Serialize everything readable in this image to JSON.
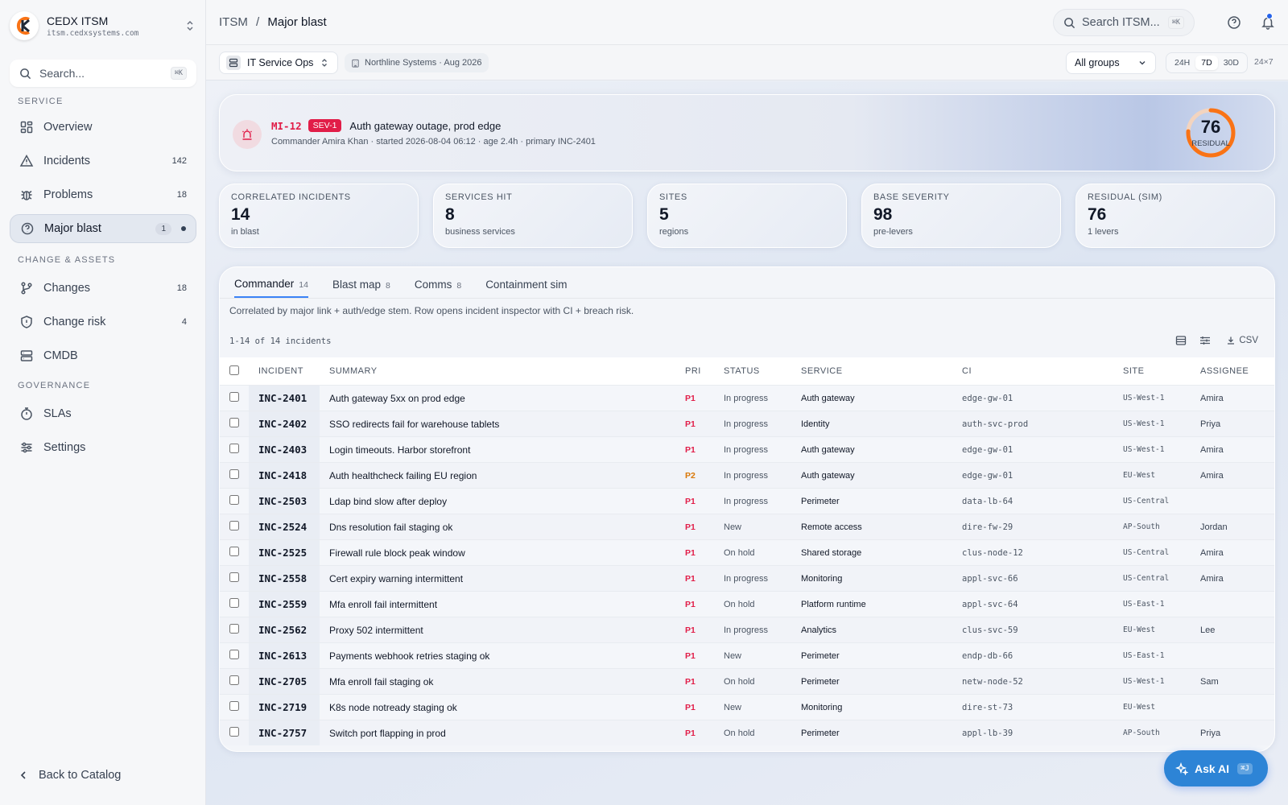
{
  "brand": {
    "name": "CEDX ITSM",
    "host": "itsm.cedxsystems.com"
  },
  "sidebar": {
    "search_placeholder": "Search...",
    "search_kbd": "⌘K",
    "sections": [
      "SERVICE",
      "CHANGE & ASSETS",
      "GOVERNANCE"
    ],
    "items": [
      {
        "label": "Overview",
        "count": "",
        "icon": "grid-icon"
      },
      {
        "label": "Incidents",
        "count": "142",
        "icon": "alert-triangle-icon"
      },
      {
        "label": "Problems",
        "count": "18",
        "icon": "bug-icon"
      },
      {
        "label": "Major blast",
        "count": "1",
        "icon": "help-circle-icon",
        "active": true
      },
      {
        "label": "Changes",
        "count": "18",
        "icon": "git-branch-icon"
      },
      {
        "label": "Change risk",
        "count": "4",
        "icon": "shield-icon"
      },
      {
        "label": "CMDB",
        "count": "",
        "icon": "server-icon"
      },
      {
        "label": "SLAs",
        "count": "",
        "icon": "timer-icon"
      },
      {
        "label": "Settings",
        "count": "",
        "icon": "sliders-icon"
      }
    ],
    "back_label": "Back to Catalog"
  },
  "topbar": {
    "crumb_root": "ITSM",
    "crumb_sep": "/",
    "crumb_current": "Major blast",
    "search_placeholder": "Search ITSM...",
    "search_kbd": "⌘K"
  },
  "subbar": {
    "workspace": "IT Service Ops",
    "context": "Northline Systems · Aug 2026",
    "group_select": "All groups",
    "ranges": [
      "24H",
      "7D",
      "30D"
    ],
    "range_active": "7D",
    "coverage": "24×7"
  },
  "hero": {
    "id": "MI-12",
    "severity": "SEV-1",
    "title": "Auth gateway outage, prod edge",
    "meta": "Commander Amira Khan · started 2026-08-04 06:12 · age 2.4h · primary INC-2401",
    "gauge_value": "76",
    "gauge_label": "RESIDUAL",
    "gauge_fraction": 0.76,
    "colors": {
      "accent": "#e11d48",
      "gauge": "#f97316"
    }
  },
  "kpis": [
    {
      "label": "CORRELATED INCIDENTS",
      "value": "14",
      "sub": "in blast"
    },
    {
      "label": "SERVICES HIT",
      "value": "8",
      "sub": "business services"
    },
    {
      "label": "SITES",
      "value": "5",
      "sub": "regions"
    },
    {
      "label": "BASE SEVERITY",
      "value": "98",
      "sub": "pre-levers"
    },
    {
      "label": "RESIDUAL (SIM)",
      "value": "76",
      "sub": "1 levers"
    }
  ],
  "tabs": [
    {
      "label": "Commander",
      "count": "14"
    },
    {
      "label": "Blast map",
      "count": "8"
    },
    {
      "label": "Comms",
      "count": "8"
    },
    {
      "label": "Containment sim",
      "count": ""
    }
  ],
  "description": "Correlated by major link + auth/edge stem. Row opens incident inspector with CI + breach risk.",
  "range_text": "1-14 of 14 incidents",
  "csv_label": "CSV",
  "columns": [
    "INCIDENT",
    "SUMMARY",
    "PRI",
    "STATUS",
    "SERVICE",
    "CI",
    "SITE",
    "ASSIGNEE"
  ],
  "rows": [
    {
      "id": "INC-2401",
      "summary": "Auth gateway 5xx on prod edge",
      "pri": "P1",
      "status": "In progress",
      "service": "Auth gateway",
      "ci": "edge-gw-01",
      "site": "US-West-1",
      "assignee": "Amira"
    },
    {
      "id": "INC-2402",
      "summary": "SSO redirects fail for warehouse tablets",
      "pri": "P1",
      "status": "In progress",
      "service": "Identity",
      "ci": "auth-svc-prod",
      "site": "US-West-1",
      "assignee": "Priya"
    },
    {
      "id": "INC-2403",
      "summary": "Login timeouts. Harbor storefront",
      "pri": "P1",
      "status": "In progress",
      "service": "Auth gateway",
      "ci": "edge-gw-01",
      "site": "US-West-1",
      "assignee": "Amira"
    },
    {
      "id": "INC-2418",
      "summary": "Auth healthcheck failing EU region",
      "pri": "P2",
      "status": "In progress",
      "service": "Auth gateway",
      "ci": "edge-gw-01",
      "site": "EU-West",
      "assignee": "Amira"
    },
    {
      "id": "INC-2503",
      "summary": "Ldap bind slow after deploy",
      "pri": "P1",
      "status": "In progress",
      "service": "Perimeter",
      "ci": "data-lb-64",
      "site": "US-Central",
      "assignee": ""
    },
    {
      "id": "INC-2524",
      "summary": "Dns resolution fail staging ok",
      "pri": "P1",
      "status": "New",
      "service": "Remote access",
      "ci": "dire-fw-29",
      "site": "AP-South",
      "assignee": "Jordan"
    },
    {
      "id": "INC-2525",
      "summary": "Firewall rule block peak window",
      "pri": "P1",
      "status": "On hold",
      "service": "Shared storage",
      "ci": "clus-node-12",
      "site": "US-Central",
      "assignee": "Amira"
    },
    {
      "id": "INC-2558",
      "summary": "Cert expiry warning intermittent",
      "pri": "P1",
      "status": "In progress",
      "service": "Monitoring",
      "ci": "appl-svc-66",
      "site": "US-Central",
      "assignee": "Amira"
    },
    {
      "id": "INC-2559",
      "summary": "Mfa enroll fail intermittent",
      "pri": "P1",
      "status": "On hold",
      "service": "Platform runtime",
      "ci": "appl-svc-64",
      "site": "US-East-1",
      "assignee": ""
    },
    {
      "id": "INC-2562",
      "summary": "Proxy 502 intermittent",
      "pri": "P1",
      "status": "In progress",
      "service": "Analytics",
      "ci": "clus-svc-59",
      "site": "EU-West",
      "assignee": "Lee"
    },
    {
      "id": "INC-2613",
      "summary": "Payments webhook retries staging ok",
      "pri": "P1",
      "status": "New",
      "service": "Perimeter",
      "ci": "endp-db-66",
      "site": "US-East-1",
      "assignee": ""
    },
    {
      "id": "INC-2705",
      "summary": "Mfa enroll fail staging ok",
      "pri": "P1",
      "status": "On hold",
      "service": "Perimeter",
      "ci": "netw-node-52",
      "site": "US-West-1",
      "assignee": "Sam"
    },
    {
      "id": "INC-2719",
      "summary": "K8s node notready staging ok",
      "pri": "P1",
      "status": "New",
      "service": "Monitoring",
      "ci": "dire-st-73",
      "site": "EU-West",
      "assignee": ""
    },
    {
      "id": "INC-2757",
      "summary": "Switch port flapping in prod",
      "pri": "P1",
      "status": "On hold",
      "service": "Perimeter",
      "ci": "appl-lb-39",
      "site": "AP-South",
      "assignee": "Priya"
    }
  ],
  "ask_ai": {
    "label": "Ask AI",
    "kbd": "⌘J"
  }
}
